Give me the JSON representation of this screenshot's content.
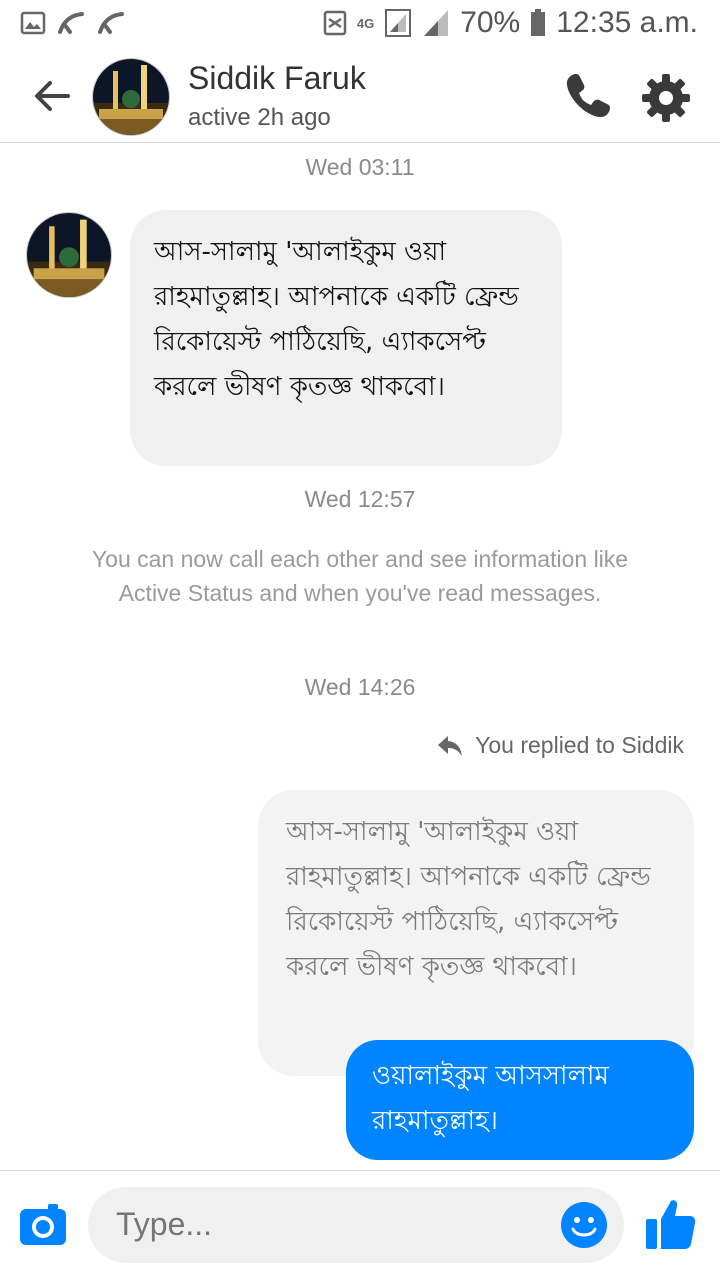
{
  "status_bar": {
    "network": "4G",
    "battery": "70%",
    "time": "12:35 a.m."
  },
  "header": {
    "name": "Siddik Faruk",
    "status": "active 2h ago"
  },
  "messages": {
    "ts1": "Wed 03:11",
    "incoming_text": "আস-সালামু 'আলাইকুম ওয়া রাহমাতুল্লাহ। আপনাকে একটি ফ্রেন্ড রিকোয়েস্ট পাঠিয়েছি, এ্যাকসেপ্ট করলে ভীষণ কৃতজ্ঞ থাকবো।",
    "ts2": "Wed 12:57",
    "system_text": "You can now call each other and see information like Active Status and when you've read messages.",
    "ts3": "Wed 14:26",
    "replied_label": "You replied to Siddik",
    "quoted_text": "আস-সালামু 'আলাইকুম ওয়া রাহমাতুল্লাহ। আপনাকে একটি ফ্রেন্ড রিকোয়েস্ট পাঠিয়েছি, এ্যাকসেপ্ট করলে ভীষণ কৃতজ্ঞ থাকবো।",
    "outgoing_text": "ওয়ালাইকুম আসসালাম রাহমাতুল্লাহ।"
  },
  "composer": {
    "placeholder": "Type..."
  },
  "colors": {
    "accent": "#0084ff",
    "bubble_in": "#f1f0f0"
  },
  "icons": [
    "back-arrow-icon",
    "phone-icon",
    "gear-icon",
    "camera-icon",
    "emoji-icon",
    "thumbs-up-icon",
    "reply-arrow-icon"
  ]
}
